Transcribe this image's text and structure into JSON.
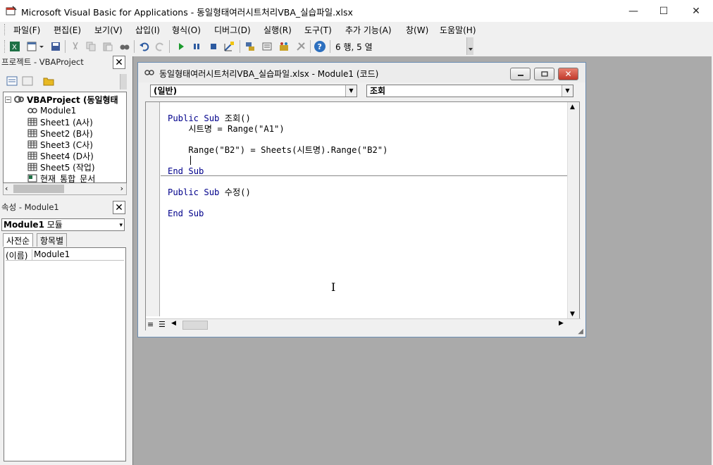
{
  "app": {
    "title": "Microsoft Visual Basic for Applications - 동일형태여러시트처리VBA_실습파일.xlsx"
  },
  "window_controls": {
    "minimize": "—",
    "maximize": "☐",
    "close": "✕"
  },
  "menu": [
    "파일(F)",
    "편집(E)",
    "보기(V)",
    "삽입(I)",
    "형식(O)",
    "디버그(D)",
    "실행(R)",
    "도구(T)",
    "추가 기능(A)",
    "창(W)",
    "도움말(H)"
  ],
  "toolbar": {
    "position": "6 행, 5 열"
  },
  "project_pane": {
    "title": "프로젝트 - VBAProject",
    "tree": [
      {
        "label": "VBAProject (동일형태",
        "bold": true
      },
      {
        "label": "Module1"
      },
      {
        "label": "Sheet1 (A사)"
      },
      {
        "label": "Sheet2 (B사)"
      },
      {
        "label": "Sheet3 (C사)"
      },
      {
        "label": "Sheet4 (D사)"
      },
      {
        "label": "Sheet5 (작업)"
      },
      {
        "label": "현재_통합_문서"
      }
    ]
  },
  "properties_pane": {
    "title": "속성 - Module1",
    "selected_object": "Module1",
    "selected_type": "모듈",
    "tabs": [
      "사전순",
      "항목별"
    ],
    "rows": [
      {
        "name": "(이름)",
        "value": "Module1"
      }
    ]
  },
  "code_window": {
    "title": "동일형태여러시트처리VBA_실습파일.xlsx - Module1 (코드)",
    "object_combo": "(일반)",
    "procedure_combo": "조회",
    "lines": [
      "Public Sub 조회()",
      "    시트명 = Range(\"A1\")",
      "",
      "    Range(\"B2\") = Sheets(시트명).Range(\"B2\")",
      "",
      "End Sub",
      "",
      "Public Sub 수정()",
      "",
      "End Sub"
    ]
  }
}
